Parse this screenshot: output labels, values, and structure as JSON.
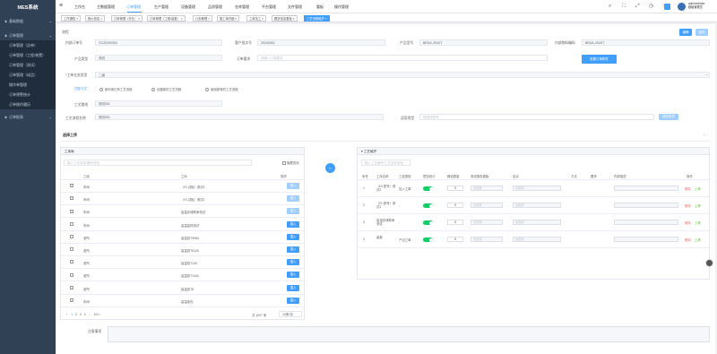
{
  "app": {
    "title": "MES系统"
  },
  "sidebar": {
    "items": [
      {
        "label": "基础数据",
        "level": 0
      },
      {
        "label": "订单管理",
        "level": 0
      },
      {
        "label": "订单管理（总单）",
        "level": 1
      },
      {
        "label": "订单管理（工程/装置）",
        "level": 1
      },
      {
        "label": "订单管理（测试）",
        "level": 1
      },
      {
        "label": "订单管理（成品）",
        "level": 1
      },
      {
        "label": "操作单管理",
        "level": 1
      },
      {
        "label": "订单预警统计",
        "level": 1
      },
      {
        "label": "订单操作履历",
        "level": 1
      },
      {
        "label": "订单报表",
        "level": 0
      }
    ]
  },
  "topnav": [
    "工作台",
    "主数据管理",
    "订单管理",
    "生产管理",
    "设备管理",
    "品质管理",
    "仓库管理",
    "平台管理",
    "文件管理",
    "看板",
    "操作管理"
  ],
  "user": {
    "name": "administrator",
    "role": "超级管理员"
  },
  "tabs": [
    "工作通知",
    "报价信息",
    "订单管理（作业）",
    "订单管理（工程/装置）",
    "计划管理",
    "施工单详细",
    "工单加工",
    "跟进信息看板",
    "工艺流程维护"
  ],
  "header": {
    "subtitle": "流程",
    "edit_label": "编辑",
    "save_label": "保存"
  },
  "form": {
    "internal_order_label": "内部订单号",
    "internal_order": "GC20200904",
    "customer_contract_label": "客户批次号",
    "customer_contract": "20200402",
    "product_model_label": "产品型号",
    "product_model": "BEDA-JSJGT",
    "material_code_label": "内部物料编码",
    "material_code": "BEDA-JSJGT",
    "product_type_label": "产品类型",
    "product_type": "测试",
    "order_req_label": "订单要求",
    "order_req_placeholder": "请输入订单要求",
    "view_order_button": "查看订单附件",
    "process_type_label": "*工单业务类型",
    "process_type": "二级",
    "radio_label": "匹配方式",
    "radio_options": [
      "新利用已有工艺流程",
      "创建新的工艺流程",
      "使用原有的工艺流程"
    ],
    "route_label": "工艺路线",
    "route": "测试001",
    "flow_name_label": "工艺流程名称",
    "flow_name": "测试001",
    "applicable_label": "适用类型",
    "applicable_placeholder": "请选择型号",
    "applicable_button": "保存型号"
  },
  "section_title": "选择工序",
  "left_panel": {
    "title": "工序库",
    "search_placeholder": "输入工序名称/编号查找",
    "check_label": "隐藏查找",
    "headers": [
      "工段",
      "工序",
      "操作"
    ],
    "rows": [
      {
        "section": "车间",
        "process": "（IS-试板）测试2",
        "action": "插入",
        "checked": true,
        "disabled": true
      },
      {
        "section": "车间",
        "process": "（IS-试板）测试1",
        "action": "插入",
        "checked": true,
        "disabled": true
      },
      {
        "section": "车间",
        "process": "高温存储寿命测试",
        "action": "插入",
        "checked": true,
        "disabled": true
      },
      {
        "section": "车间",
        "process": "高温高低测试",
        "action": "插入",
        "checked": false,
        "disabled": false
      },
      {
        "section": "老所",
        "process": "高温双T5084",
        "action": "插入",
        "checked": false,
        "disabled": false
      },
      {
        "section": "老所",
        "process": "高温双T5125",
        "action": "插入",
        "checked": false,
        "disabled": false
      },
      {
        "section": "老所",
        "process": "高温双T130",
        "action": "插入",
        "checked": false,
        "disabled": false
      },
      {
        "section": "老所",
        "process": "高温双T1440",
        "action": "插入",
        "checked": false,
        "disabled": false
      },
      {
        "section": "老所",
        "process": "高温双T8",
        "action": "插入",
        "checked": false,
        "disabled": false
      },
      {
        "section": "车间",
        "process": "高温老化",
        "action": "插入",
        "checked": false,
        "disabled": false
      }
    ],
    "pagination": {
      "pages": [
        "1",
        "2",
        "3",
        "4",
        "...",
        "101"
      ],
      "total": "共 1007 条",
      "size": "10条/页"
    }
  },
  "right_panel": {
    "title": "工艺维护",
    "search_placeholder": "输入工艺编号/工艺名称查找",
    "headers": [
      "序号",
      "工序名称",
      "工段类型",
      "是否统计",
      "报检数量",
      "测试报告模板",
      "站点",
      "方法",
      "要求",
      "内部描述",
      "操作"
    ],
    "rows": [
      {
        "index": "1",
        "name": "（IS-型号）测试2",
        "type": "加入工单",
        "qty": "0",
        "tpl_placeholder": "请选择",
        "site_placeholder": "请选择",
        "op_del": "删除",
        "op_up": "上移"
      },
      {
        "index": "2",
        "name": "（IS-型号）测试1",
        "type": "-",
        "qty": "0",
        "tpl_placeholder": "请选择",
        "site_placeholder": "请选择",
        "op_del": "删除",
        "op_up": "上移"
      },
      {
        "index": "3",
        "name": "高温存储寿命测试",
        "type": "-",
        "qty": "0",
        "tpl_placeholder": "请选择",
        "site_placeholder": "请选择",
        "op_del": "删除",
        "op_up": "上移"
      },
      {
        "index": "4",
        "name": "装卷",
        "type": "产出工单",
        "qty": "0",
        "tpl_placeholder": "请选择",
        "site_placeholder": "请选择",
        "op_del": "删除",
        "op_up": "上移"
      }
    ]
  },
  "notes_label": "注意事项",
  "colors": {
    "sidebar": "#304156",
    "accent": "#409eff",
    "toggle_on": "#13ce66"
  }
}
